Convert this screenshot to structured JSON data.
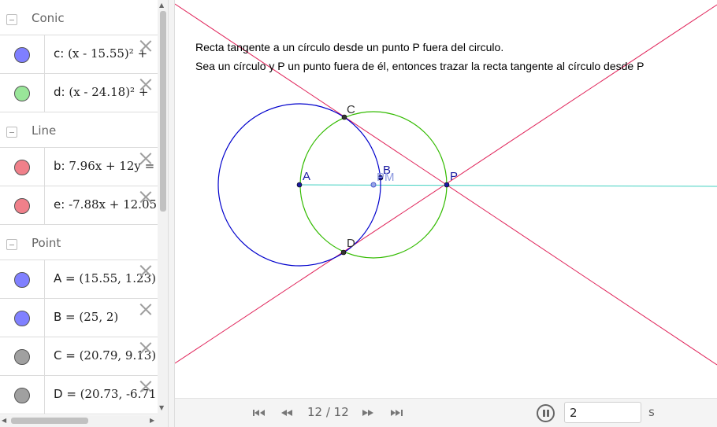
{
  "algebra": {
    "groups": [
      {
        "title": "Conic",
        "items": [
          {
            "label": "c: ",
            "expr": "(x - 15.55)² +",
            "color": "#7f7fff"
          },
          {
            "label": "d: ",
            "expr": "(x - 24.18)² +",
            "color": "#99e699"
          }
        ]
      },
      {
        "title": "Line",
        "items": [
          {
            "label": "b: ",
            "expr": "7.96x + 12y =",
            "color": "#f0808a"
          },
          {
            "label": "e: ",
            "expr": "-7.88x + 12.05",
            "color": "#f0808a"
          }
        ]
      },
      {
        "title": "Point",
        "items": [
          {
            "label": "A = ",
            "expr": "(15.55, 1.23)",
            "color": "#8080ff"
          },
          {
            "label": "B = ",
            "expr": "(25, 2)",
            "color": "#8080ff"
          },
          {
            "label": "C = ",
            "expr": "(20.79, 9.13)",
            "color": "#a0a0a0"
          },
          {
            "label": "D = ",
            "expr": "(20.73, -6.71",
            "color": "#a0a0a0"
          }
        ]
      }
    ]
  },
  "graphics": {
    "text_line1": "Recta tangente a un círculo desde un punto P fuera del circulo.",
    "text_line2": "Sea un círculo y P un punto fuera de él, entonces trazar la recta tangente al círculo desde P",
    "point_labels": {
      "A": "A",
      "B": "B",
      "C": "C",
      "D": "D",
      "P": "P",
      "M": "PM"
    },
    "colors": {
      "circle_c": "#0000cc",
      "circle_d": "#33bb00",
      "tangent": "#e0245a",
      "segment": "#40d0c0",
      "point": "#1a1aa0",
      "point_dark": "#333333"
    }
  },
  "playback": {
    "page": "12 / 12",
    "speed": "2",
    "unit": "s"
  }
}
